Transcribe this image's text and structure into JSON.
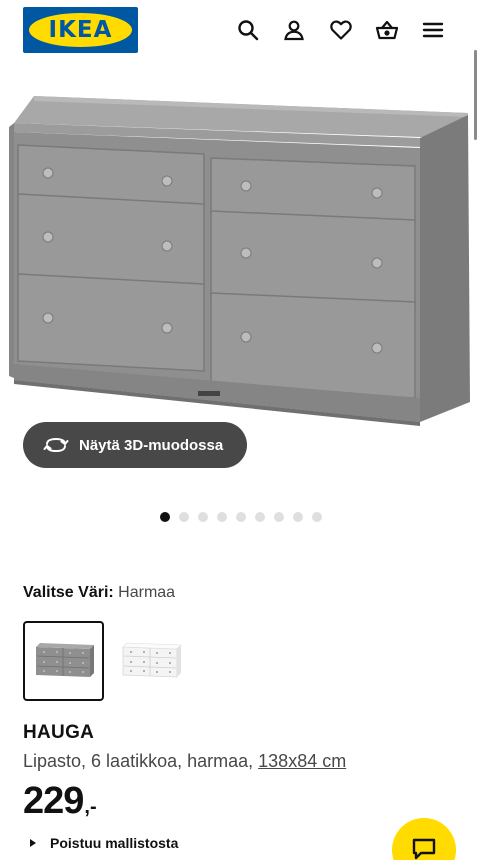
{
  "header": {
    "logo_text": "IKEA",
    "icons": [
      "search-icon",
      "account-icon",
      "heart-icon",
      "basket-icon",
      "menu-icon"
    ]
  },
  "gallery": {
    "view_3d_label": "Näytä 3D-muodossa",
    "dot_count": 9,
    "active_dot": 0
  },
  "color_select": {
    "label": "Valitse Väri:",
    "value": "Harmaa",
    "swatches": [
      {
        "name": "grey",
        "selected": true
      },
      {
        "name": "white",
        "selected": false
      }
    ]
  },
  "product": {
    "name": "HAUGA",
    "description": "Lipasto, 6 laatikkoa, harmaa,",
    "dimensions": "138x84 cm",
    "price_integer": "229",
    "price_suffix": ",-",
    "availability": "Poistuu mallistosta"
  },
  "colors": {
    "ikea_blue": "#0058a3",
    "ikea_yellow": "#ffdb00",
    "dark_button": "#484848",
    "dresser_grey": "#8f8f8f"
  }
}
